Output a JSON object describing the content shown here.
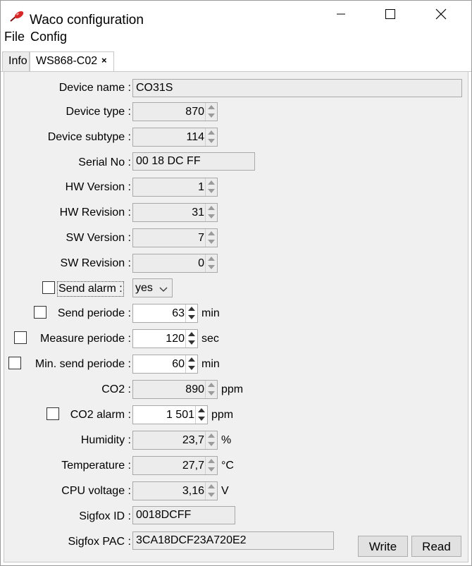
{
  "window": {
    "title": "Waco configuration"
  },
  "menu": [
    "File",
    "Config"
  ],
  "tabs": {
    "info": "Info",
    "device": "WS868-C02",
    "close_glyph": "×"
  },
  "fields": {
    "device_name": {
      "label": "Device name :",
      "value": "CO31S"
    },
    "device_type": {
      "label": "Device type :",
      "value": "870"
    },
    "device_subtype": {
      "label": "Device subtype :",
      "value": "114"
    },
    "serial_no": {
      "label": "Serial No :",
      "value": "00 18 DC FF"
    },
    "hw_version": {
      "label": "HW Version :",
      "value": "1"
    },
    "hw_revision": {
      "label": "HW Revision :",
      "value": "31"
    },
    "sw_version": {
      "label": "SW Version :",
      "value": "7"
    },
    "sw_revision": {
      "label": "SW Revision :",
      "value": "0"
    },
    "send_alarm": {
      "label": "Send alarm :",
      "value": "yes",
      "checked": false
    },
    "send_periode": {
      "label": "Send periode :",
      "value": "63",
      "unit": "min",
      "checked": false
    },
    "measure_periode": {
      "label": "Measure periode :",
      "value": "120",
      "unit": "sec",
      "checked": false
    },
    "min_send_periode": {
      "label": "Min. send periode :",
      "value": "60",
      "unit": "min",
      "checked": false
    },
    "co2": {
      "label": "CO2 :",
      "value": "890",
      "unit": "ppm"
    },
    "co2_alarm": {
      "label": "CO2 alarm :",
      "value": "1 501",
      "unit": "ppm",
      "checked": false
    },
    "humidity": {
      "label": "Humidity :",
      "value": "23,7",
      "unit": "%"
    },
    "temperature": {
      "label": "Temperature :",
      "value": "27,7",
      "unit": "°C"
    },
    "cpu_voltage": {
      "label": "CPU voltage :",
      "value": "3,16",
      "unit": "V"
    },
    "sigfox_id": {
      "label": "Sigfox ID :",
      "value": "0018DCFF"
    },
    "sigfox_pac": {
      "label": "Sigfox PAC :",
      "value": "3CA18DCF23A720E2"
    }
  },
  "buttons": {
    "write": "Write",
    "read": "Read"
  },
  "icons": {
    "app": "red-pin-icon",
    "minimize": "minimize-icon",
    "maximize": "maximize-icon",
    "close": "close-icon",
    "spin": "spinner-arrows-icon",
    "dropdown": "chevron-down-icon"
  }
}
